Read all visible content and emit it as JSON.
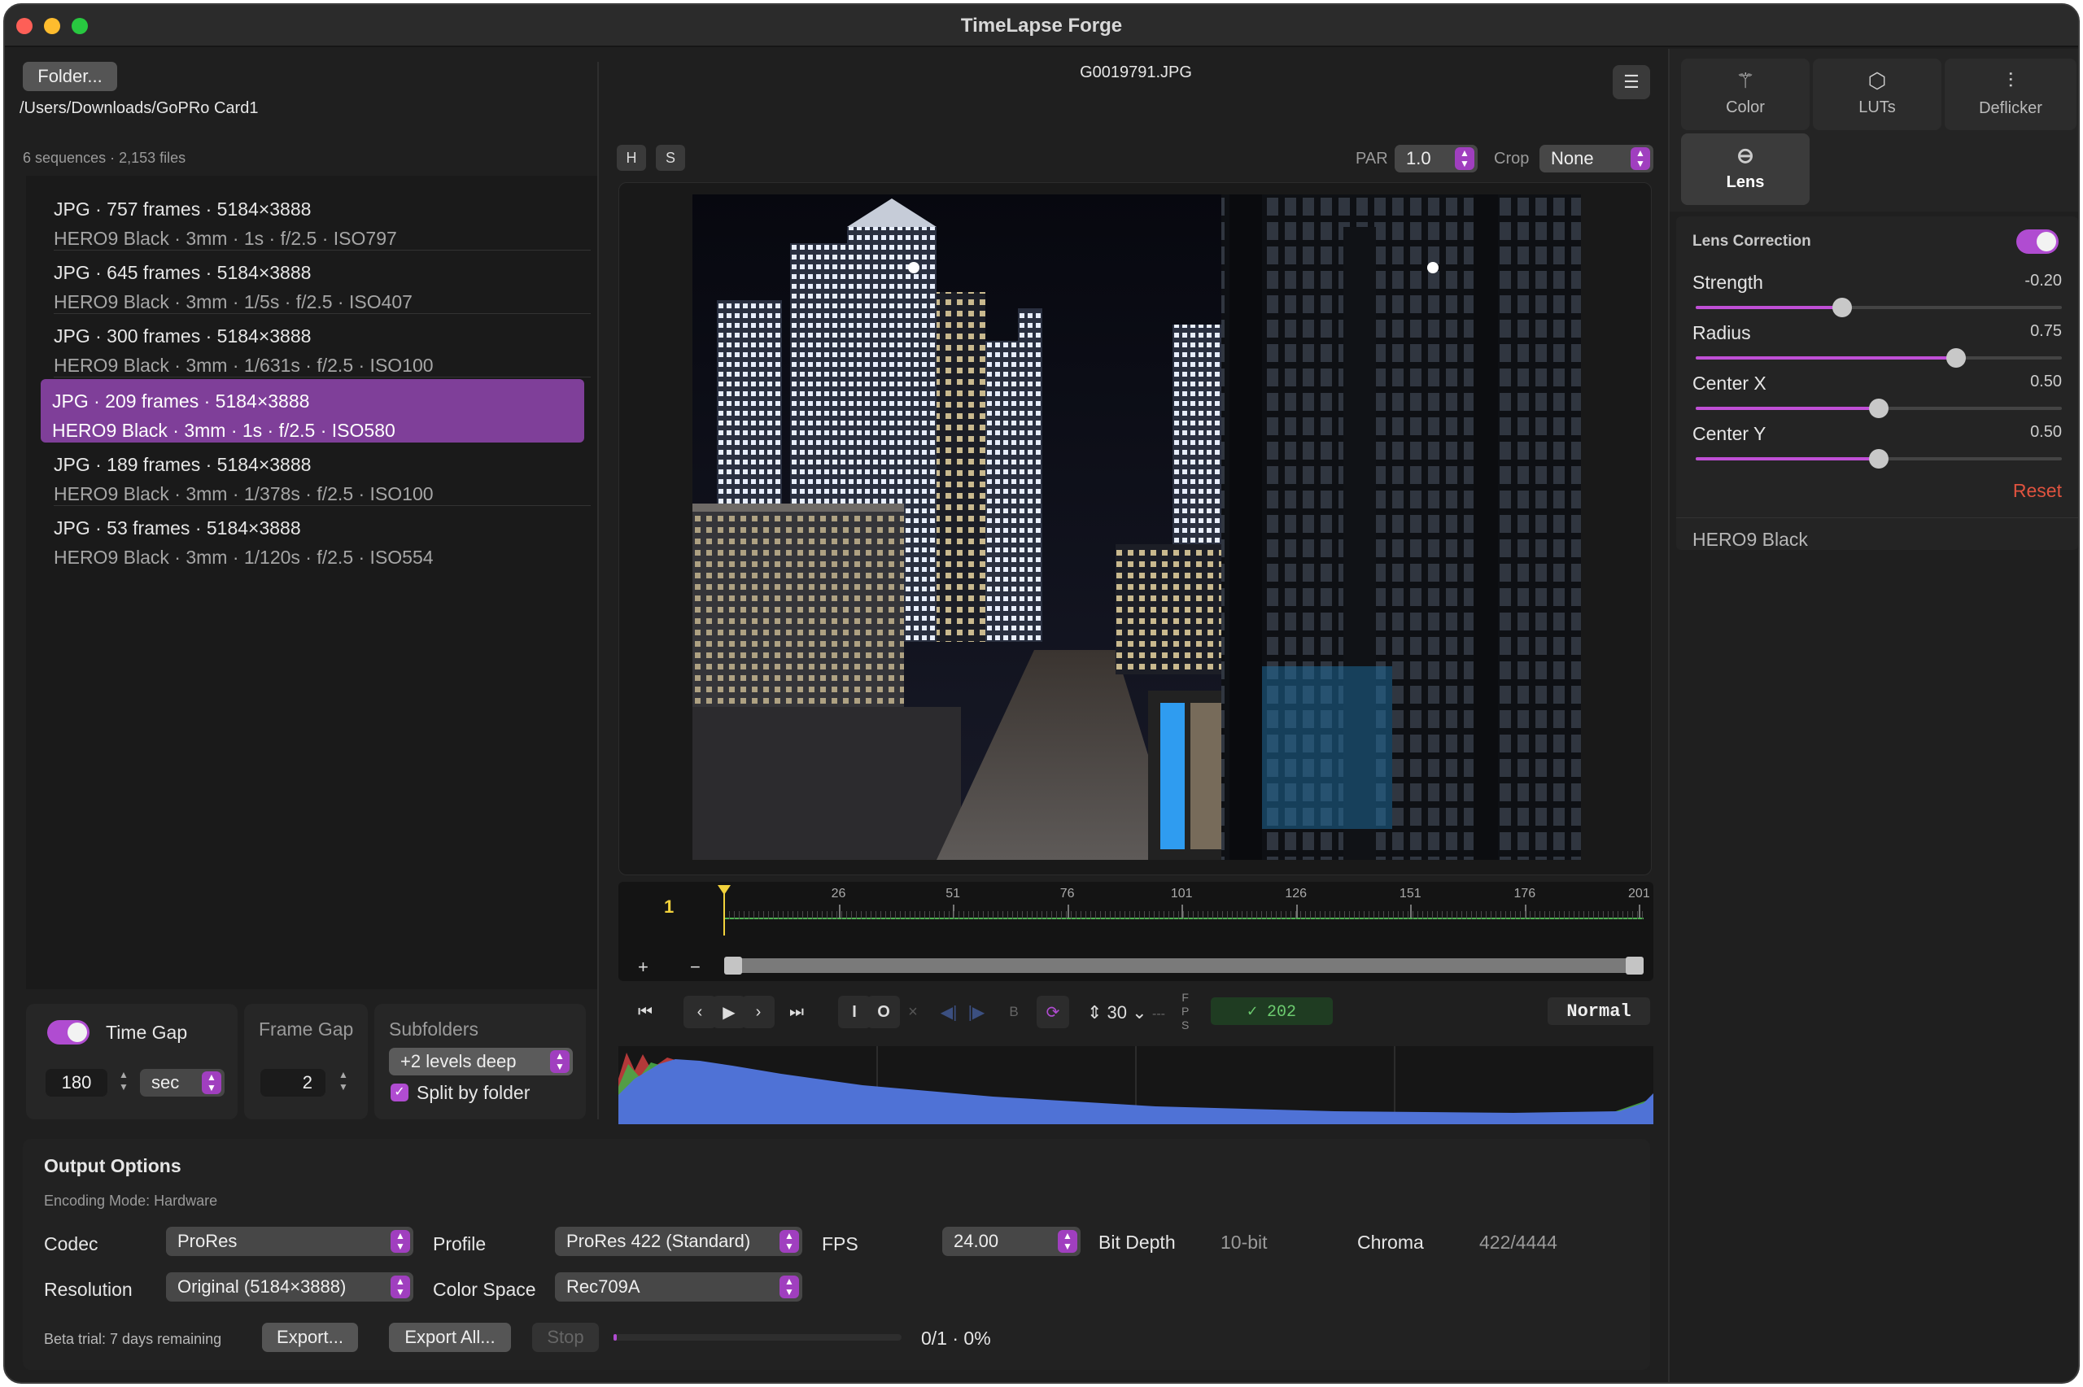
{
  "window": {
    "title": "TimeLapse Forge"
  },
  "sidebar": {
    "folder_button": "Folder...",
    "path": "/Users/Downloads/GoPRo Card1",
    "summary": "6 sequences · 2,153 files",
    "sequences": [
      {
        "title": "JPG · 757 frames · 5184×3888",
        "detail": "HERO9 Black · 3mm · 1s · f/2.5 · ISO797"
      },
      {
        "title": "JPG · 645 frames · 5184×3888",
        "detail": "HERO9 Black · 3mm · 1/5s · f/2.5 · ISO407"
      },
      {
        "title": "JPG · 300 frames · 5184×3888",
        "detail": "HERO9 Black · 3mm · 1/631s · f/2.5 · ISO100"
      },
      {
        "title": "JPG · 209 frames · 5184×3888",
        "detail": "HERO9 Black · 3mm · 1s · f/2.5 · ISO580"
      },
      {
        "title": "JPG · 189 frames · 5184×3888",
        "detail": "HERO9 Black · 3mm · 1/378s · f/2.5 · ISO100"
      },
      {
        "title": "JPG · 53 frames · 5184×3888",
        "detail": "HERO9 Black · 3mm · 1/120s · f/2.5 · ISO554"
      }
    ],
    "selected_index": 3
  },
  "grouping": {
    "time_gap_label": "Time Gap",
    "time_gap_value": "180",
    "time_gap_unit": "sec",
    "time_gap_enabled": true,
    "frame_gap_label": "Frame Gap",
    "frame_gap_value": "2",
    "subfolders_label": "Subfolders",
    "subfolders_value": "+2 levels deep",
    "split_by_folder_label": "Split by folder",
    "split_by_folder_checked": true
  },
  "viewer": {
    "filename": "G0019791.JPG",
    "h_button": "H",
    "s_button": "S",
    "par_label": "PAR",
    "par_value": "1.0",
    "crop_label": "Crop",
    "crop_value": "None"
  },
  "timeline": {
    "current_frame": "1",
    "ticks": [
      "26",
      "51",
      "76",
      "101",
      "126",
      "151",
      "176",
      "201"
    ],
    "zoom_in": "+",
    "zoom_out": "−",
    "playhead_fraction": 0.0
  },
  "transport": {
    "in_label": "I",
    "out_label": "O",
    "clear_label": "×",
    "b_label": "B",
    "fps_value": "30",
    "fps_stack": [
      "F",
      "P",
      "S"
    ],
    "fps_dashes": "---",
    "frame_count": "✓ 202",
    "speed": "Normal"
  },
  "output": {
    "heading": "Output Options",
    "encoding_mode": "Encoding Mode: Hardware",
    "codec_label": "Codec",
    "codec_value": "ProRes",
    "profile_label": "Profile",
    "profile_value": "ProRes 422 (Standard)",
    "fps_label": "FPS",
    "fps_value": "24.00",
    "bit_depth_label": "Bit Depth",
    "bit_depth_value": "10-bit",
    "chroma_label": "Chroma",
    "chroma_value": "422/4444",
    "resolution_label": "Resolution",
    "resolution_value": "Original (5184×3888)",
    "color_space_label": "Color Space",
    "color_space_value": "Rec709A",
    "trial_text": "Beta trial: 7 days remaining",
    "export_button": "Export...",
    "export_all_button": "Export All...",
    "stop_button": "Stop",
    "progress_text": "0/1 · 0%",
    "progress_fraction": 0.0
  },
  "inspector": {
    "tabs": [
      {
        "label": "Color",
        "icon": "magic-wand-icon"
      },
      {
        "label": "LUTs",
        "icon": "cube-icon"
      },
      {
        "label": "Deflicker",
        "icon": "waveform-icon"
      },
      {
        "label": "Lens",
        "icon": "lens-icon"
      }
    ],
    "active_tab": "Lens",
    "lens_correction_label": "Lens Correction",
    "lens_correction_enabled": true,
    "sliders": [
      {
        "label": "Strength",
        "value": "-0.20",
        "fraction": 0.4
      },
      {
        "label": "Radius",
        "value": "0.75",
        "fraction": 0.71
      },
      {
        "label": "Center X",
        "value": "0.50",
        "fraction": 0.5
      },
      {
        "label": "Center Y",
        "value": "0.50",
        "fraction": 0.5
      }
    ],
    "reset_label": "Reset",
    "camera_model": "HERO9 Black"
  },
  "colors": {
    "accent": "#b04cd1",
    "selection": "#7f3f99",
    "reset": "#e0533f",
    "timeline_green": "#4caf50",
    "playhead": "#f2d23c"
  }
}
